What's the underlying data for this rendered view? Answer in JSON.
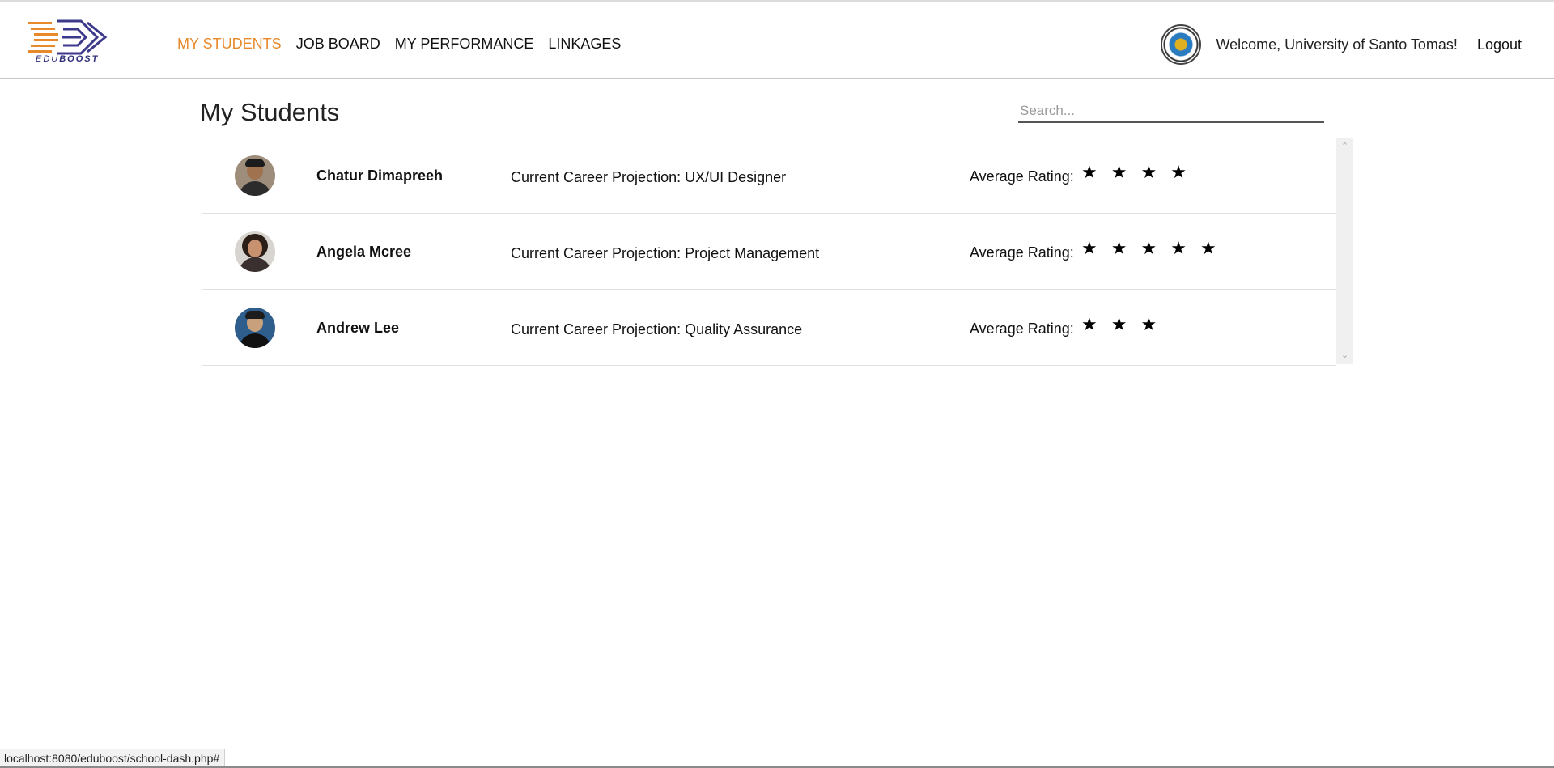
{
  "header": {
    "logo_text_a": "EDU",
    "logo_text_b": "BOOST",
    "nav": [
      {
        "label": "MY STUDENTS",
        "active": true
      },
      {
        "label": "JOB BOARD",
        "active": false
      },
      {
        "label": "MY PERFORMANCE",
        "active": false
      },
      {
        "label": "LINKAGES",
        "active": false
      }
    ],
    "welcome": "Welcome, University of Santo Tomas!",
    "logout": "Logout"
  },
  "main": {
    "title": "My Students",
    "search_placeholder": "Search...",
    "rating_label": "Average Rating:",
    "students": [
      {
        "name": "Chatur Dimapreeh",
        "career": "Current Career Projection: UX/UI Designer",
        "rating": 4
      },
      {
        "name": "Angela Mcree",
        "career": "Current Career Projection: Project Management",
        "rating": 5
      },
      {
        "name": "Andrew Lee",
        "career": "Current Career Projection: Quality Assurance",
        "rating": 3
      }
    ]
  },
  "status_url": "localhost:8080/eduboost/school-dash.php#",
  "colors": {
    "accent": "#e8892b",
    "logo_blue": "#2e2e7a"
  },
  "icons": {
    "star": "star-icon",
    "scroll_up": "chevron-up-icon",
    "scroll_down": "chevron-down-icon"
  }
}
